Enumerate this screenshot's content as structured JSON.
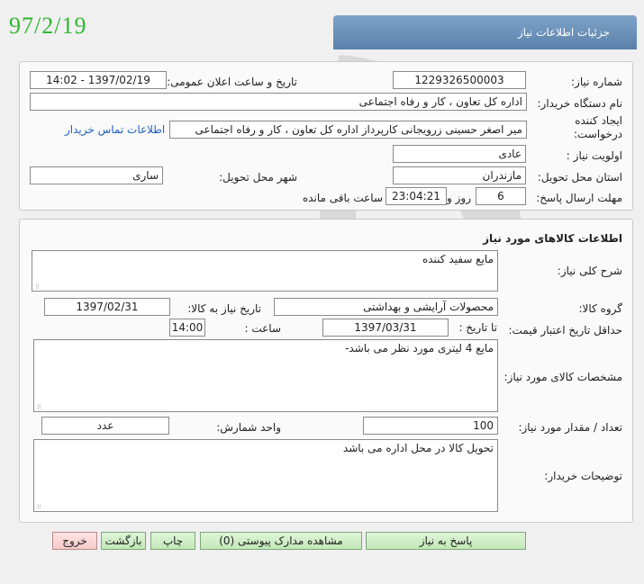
{
  "header": {
    "date": "97/2/19",
    "title": "جزئیات اطلاعات نیاز"
  },
  "info": {
    "need_number_label": "شماره نیاز:",
    "need_number": "1229326500003",
    "announce_label": "تاریخ و ساعت اعلان عمومی:",
    "announce_value": "1397/02/19 - 14:02",
    "buyer_org_label": "نام دستگاه خریدار:",
    "buyer_org": "اداره کل تعاون ، کار و رفاه اجتماعی",
    "creator_label_1": "ایجاد کننده",
    "creator_label_2": "درخواست:",
    "creator_value": "میر اصغر  حسینی زرویجانی کارپرداز اداره کل تعاون ، کار و رفاه اجتماعی",
    "contact_link": "اطلاعات تماس خریدار",
    "priority_label": "اولویت نیاز :",
    "priority": "عادی",
    "province_label": "استان محل تحویل:",
    "province": "مازندران",
    "city_label": "شهر محل تحویل:",
    "city": "ساری",
    "deadline_label": "مهلت ارسال پاسخ:",
    "days": "6",
    "days_label": "روز و",
    "time_left": "23:04:21",
    "time_left_label": "ساعت باقی مانده"
  },
  "goods": {
    "section_title": "اطلاعات کالاهای مورد نیاز",
    "general_desc_label": "شرح کلی نیاز:",
    "general_desc": "مایع سفید کننده",
    "group_label": "گروه کالا:",
    "group": "محصولات آرایشی و بهداشتی",
    "need_date_label": "تاریخ نیاز به کالا:",
    "need_date": "1397/02/31",
    "min_price_label": "حداقل تاریخ اعتبار قیمت:",
    "until_label": "تا تاریخ :",
    "until_date": "1397/03/31",
    "hour_label": "ساعت :",
    "hour": "14:00",
    "spec_label": "مشخصات کالای مورد نیاز:",
    "spec": "مایع 4 لیتری مورد نظر می باشد-",
    "qty_label": "تعداد / مقدار مورد نیاز:",
    "qty": "100",
    "unit_label": "واحد شمارش:",
    "unit": "عدد",
    "buyer_notes_label": "توضیحات خریدار:",
    "buyer_notes": "تحویل کالا در محل اداره می باشد"
  },
  "buttons": {
    "reply": "پاسخ به نیاز",
    "attachments": "مشاهده مدارک پیوستی (0)",
    "print": "چاپ",
    "back": "بازگشت",
    "exit": "خروج"
  },
  "watermark_icon": "hezareh-logo-watermark",
  "colors": {
    "date_green": "#2fb82f",
    "title_blue": "#5b81ab",
    "button_green": "#c3e8b8",
    "exit_red": "#f6caca",
    "link_blue": "#1f5fbf"
  }
}
